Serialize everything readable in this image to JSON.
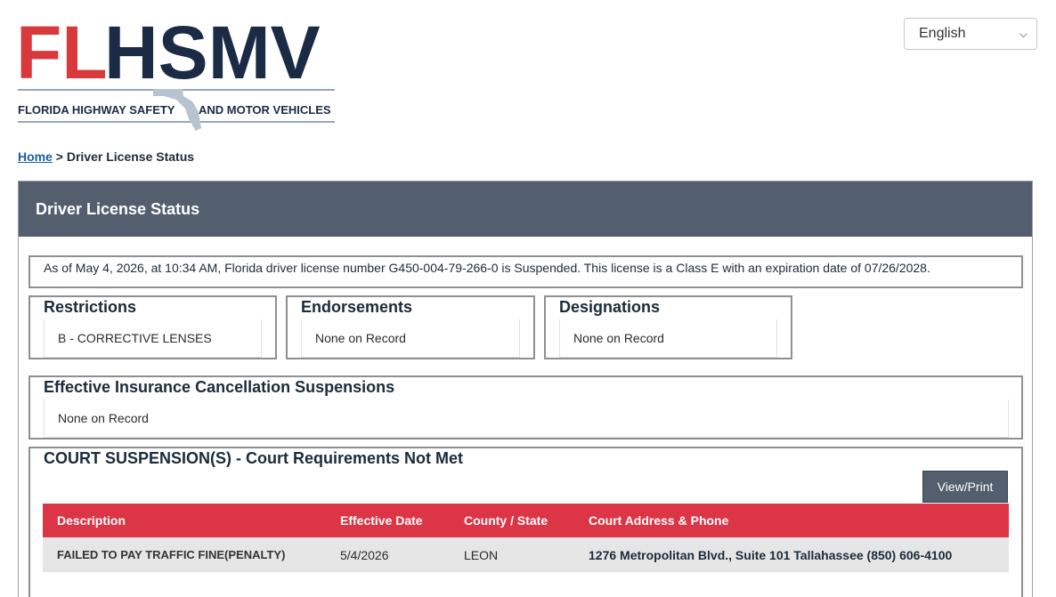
{
  "header": {
    "logo_text": "FLHSMV",
    "logo_subtitle_left": "FLORIDA HIGHWAY SAFETY",
    "logo_subtitle_right": "AND MOTOR VEHICLES",
    "language": "English",
    "colors": {
      "brand_red": "#d7393c",
      "brand_navy": "#1b2a45",
      "header_gray": "#535f6e",
      "table_red": "#dc3545"
    }
  },
  "breadcrumb": {
    "home": "Home",
    "separator": ">",
    "current": "Driver License Status"
  },
  "panel": {
    "title": "Driver License Status",
    "status_text": "As of May 4, 2026, at 10:34 AM, Florida driver license number G450-004-79-266-0 is Suspended. This license is a Class E with an expiration date of 07/26/2028.",
    "restrictions": {
      "title": "Restrictions",
      "value": "B - CORRECTIVE LENSES"
    },
    "endorsements": {
      "title": "Endorsements",
      "value": "None on Record"
    },
    "designations": {
      "title": "Designations",
      "value": "None on Record"
    },
    "insurance": {
      "title": "Effective Insurance Cancellation Suspensions",
      "value": "None on Record"
    },
    "court": {
      "title": "COURT SUSPENSION(S) - Court Requirements Not Met",
      "view_print": "View/Print",
      "columns": [
        "Description",
        "Effective Date",
        "County / State",
        "Court Address & Phone"
      ],
      "rows": [
        [
          "FAILED TO PAY TRAFFIC FINE(PENALTY)",
          "5/4/2026",
          "LEON",
          "1276 Metropolitan Blvd., Suite 101 Tallahassee (850) 606-4100"
        ]
      ]
    }
  }
}
